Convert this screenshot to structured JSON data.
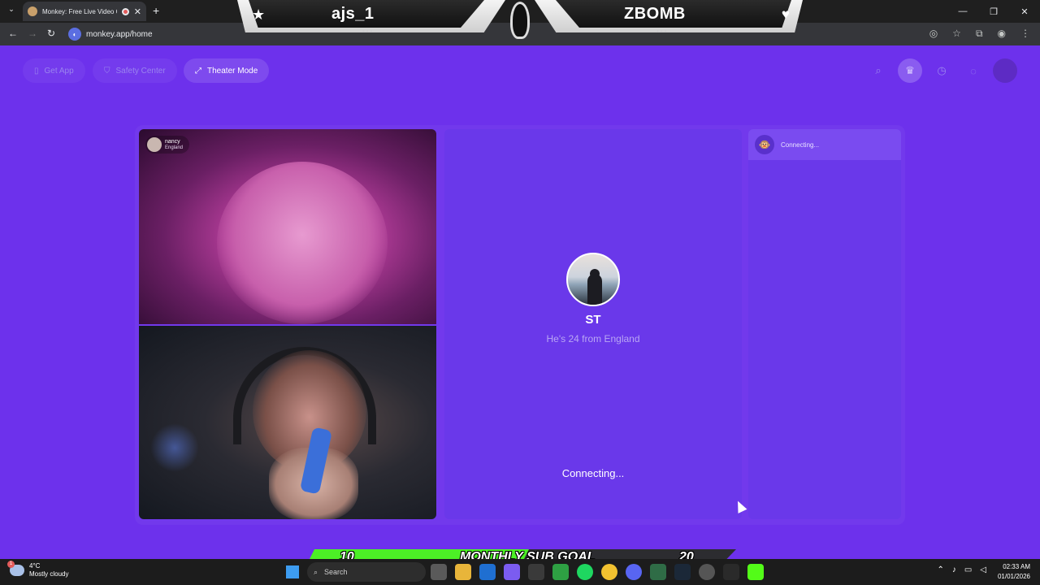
{
  "browser": {
    "tab_title": "Monkey: Free Live Video Ch",
    "url": "monkey.app/home",
    "new_tab": "+",
    "close_tab": "✕"
  },
  "stream_overlay": {
    "left_name": "ajs_1",
    "right_name": "ZBOMB"
  },
  "toolbar": {
    "get_app": "Get App",
    "safety_center": "Safety Center",
    "theater_mode": "Theater Mode"
  },
  "partner_video": {
    "name": "nancy",
    "location": "England"
  },
  "match_card": {
    "name": "ST",
    "description": "He's 24 from England",
    "status": "Connecting..."
  },
  "chat_panel": {
    "status": "Connecting..."
  },
  "sub_goal": {
    "current": "10",
    "label": "MONTHLY SUB GOAL",
    "target": "20",
    "progress_fraction": 0.5,
    "fill_color": "#4cf026"
  },
  "taskbar": {
    "weather_temp": "4°C",
    "weather_desc": "Mostly cloudy",
    "weather_badge": "1",
    "search_label": "Search",
    "time": "02:33 AM",
    "date": "01/01/2026"
  },
  "colors": {
    "page_bg": "#6d31ec",
    "panel_bg": "#6a38ea",
    "accent_light": "#b9a6f4"
  }
}
